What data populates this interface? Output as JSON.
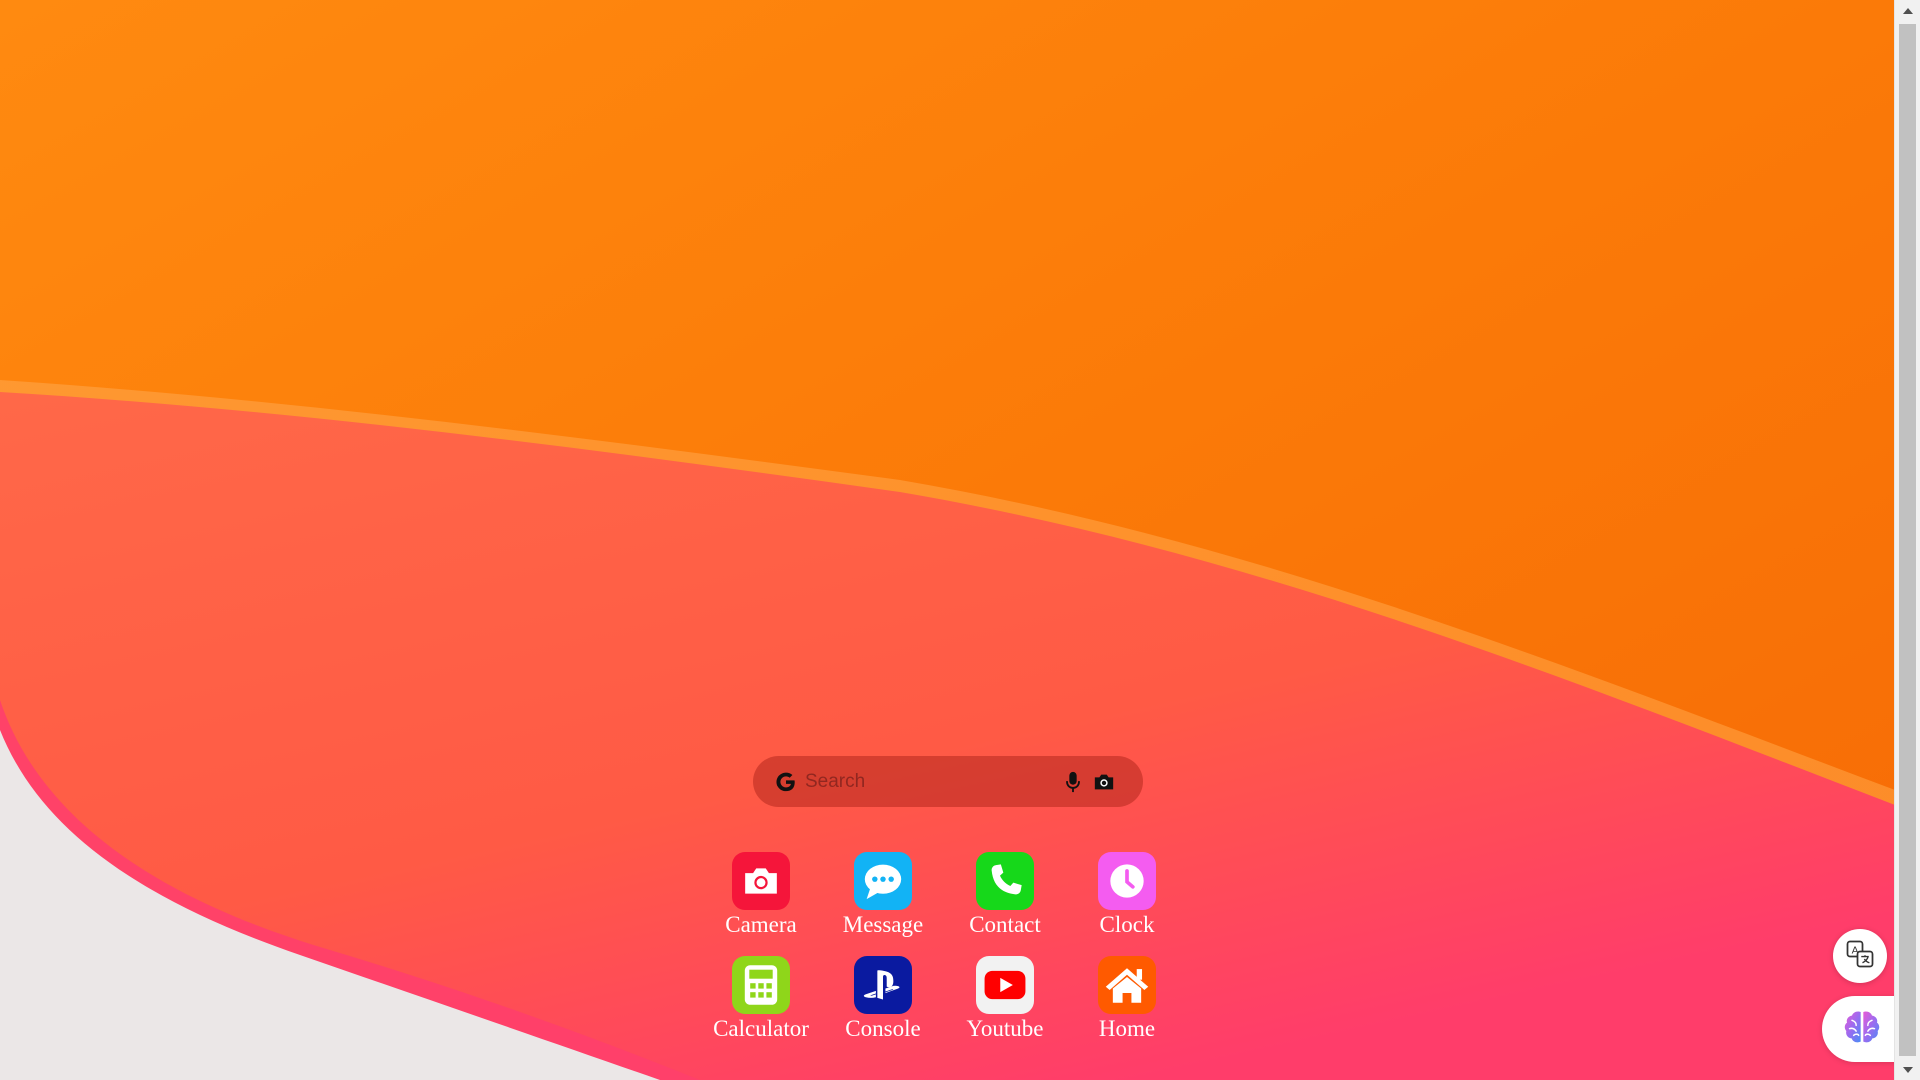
{
  "search": {
    "placeholder": "Search"
  },
  "apps": [
    {
      "label": "Camera",
      "icon": "camera-icon",
      "color": "#f5153a"
    },
    {
      "label": "Message",
      "icon": "message-icon",
      "color": "#12b3f5"
    },
    {
      "label": "Contact",
      "icon": "phone-icon",
      "color": "#16d81a"
    },
    {
      "label": "Clock",
      "icon": "clock-icon",
      "color": "#f45cf0"
    },
    {
      "label": "Calculator",
      "icon": "calculator-icon",
      "color": "#8fd61a"
    },
    {
      "label": "Console",
      "icon": "playstation-icon",
      "color": "#0a1aa0"
    },
    {
      "label": "Youtube",
      "icon": "youtube-icon",
      "color": "#f2f2f2"
    },
    {
      "label": "Home",
      "icon": "home-icon",
      "color": "#ff5a00"
    }
  ],
  "floating": {
    "translate_icon": "translate-icon",
    "assistant_icon": "brain-icon"
  },
  "colors": {
    "wallpaper_orange": "#f57a0a",
    "wallpaper_red": "#ff5a4a",
    "wallpaper_pink": "#ff3d6a",
    "wallpaper_white": "#ebe8e8"
  }
}
